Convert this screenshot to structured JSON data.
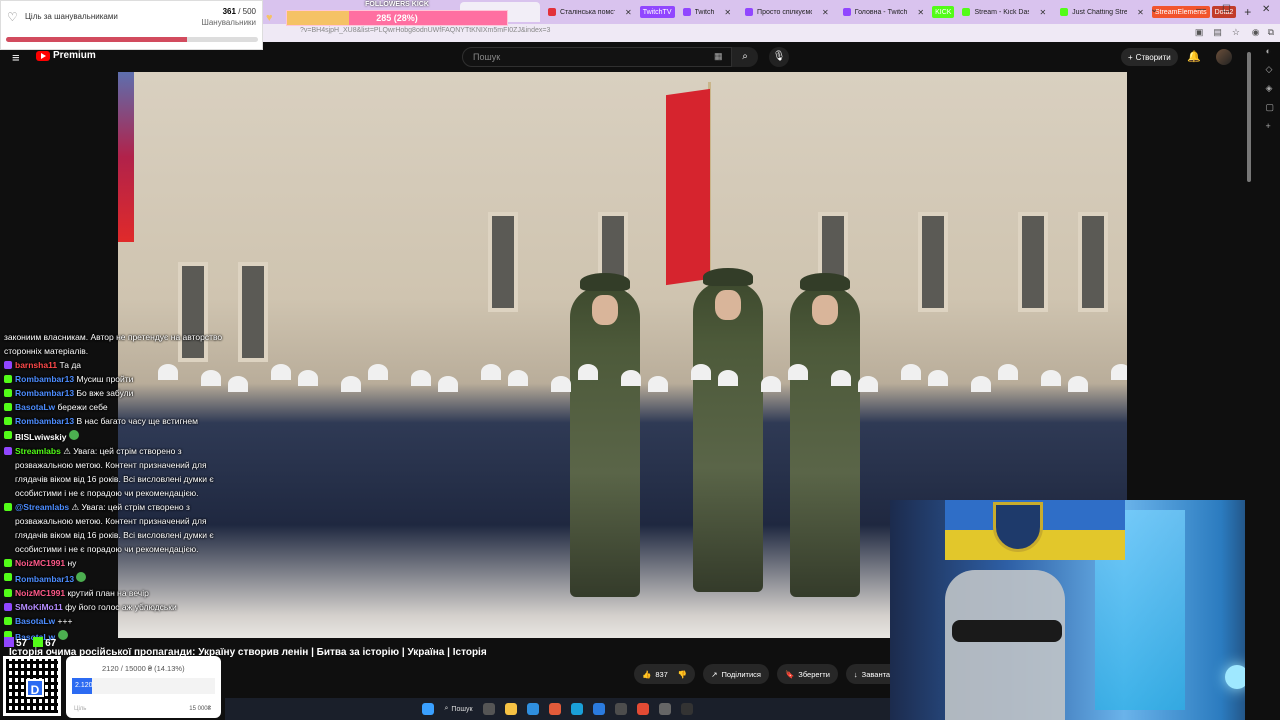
{
  "browser": {
    "tabs": [
      {
        "label": "Сталінська помста",
        "color": "#e2313a"
      },
      {
        "label": "Twitch",
        "color": "#9146ff"
      },
      {
        "label": "Просто спілкуємося",
        "color": "#9146ff"
      },
      {
        "label": "Головна - Twitch",
        "color": "#9146ff"
      },
      {
        "label": "Stream - Kick Dashboard",
        "color": "#53fc18"
      },
      {
        "label": "Just Chatting Stream",
        "color": "#53fc18"
      }
    ],
    "tab_badges": [
      "TwitchTV",
      "KICK",
      "StreamElements",
      "Dota2"
    ],
    "new_tab": "+",
    "url": "?v=BH4sjpH_XU8&list=PLQwrHobg8odnUWfFAQNYTtKNIXm5mFI0ZJ&index=3"
  },
  "youtube": {
    "logo_text": "Premium",
    "search_placeholder": "Пошук",
    "create_label": "Створити",
    "video_title": "Історія очима російської пропаганди: Україну створив ленін | Битва за історію | Україна | Історія",
    "actions": {
      "likes": "837",
      "share": "Поділитися",
      "save": "Зберегти",
      "download": "Завантажити"
    }
  },
  "overlay": {
    "goal": {
      "label": "Ціль за шанувальниками",
      "current": "361",
      "total": "500",
      "sub_label": "Шанувальники",
      "progress": 0.72
    },
    "followers": {
      "title": "FOLLOWERS KICK",
      "text": "285 (28%)",
      "progress": 0.28
    },
    "stats": [
      {
        "value": "57",
        "icon": "twitch-icon",
        "color": "#9146ff"
      },
      {
        "value": "67",
        "icon": "kick-icon",
        "color": "#53fc18"
      }
    ],
    "donation": {
      "amount_text": "2120 / 15000 ₴ (14.13%)",
      "bar_text": "2.120",
      "progress": 0.1413,
      "label": "Ціль",
      "goal_value": "15 000₴"
    }
  },
  "chat": [
    {
      "user": "",
      "user_color": "#fff",
      "badge": "",
      "msg": "закониим власникам. Автор не претендує на авторство сторонніх матеріалів."
    },
    {
      "user": "barnsha11",
      "user_color": "#ff4a4a",
      "badge": "#9146ff",
      "msg": "Та да"
    },
    {
      "user": "Rombambar13",
      "user_color": "#4d8dff",
      "badge": "#53fc18",
      "msg": "Мусиш пройти"
    },
    {
      "user": "Rombambar13",
      "user_color": "#4d8dff",
      "badge": "#53fc18",
      "msg": "Бо вже забули"
    },
    {
      "user": "BasotaLw",
      "user_color": "#4d8dff",
      "badge": "#53fc18",
      "msg": "бережи себе"
    },
    {
      "user": "Rombambar13",
      "user_color": "#4d8dff",
      "badge": "#53fc18",
      "msg": "В нас багато часу ще встигнем"
    },
    {
      "user": "BISLwiwskiy",
      "user_color": "#fff",
      "badge": "#53fc18",
      "msg": ""
    },
    {
      "user": "Streamlabs",
      "user_color": "#53fc18",
      "badge": "#9146ff",
      "msg": "⚠ Увага: цей стрім створено з розважальною метою. Контент призначений для глядачів віком від 16 років. Всі висловлені думки є особистими і не є порадою чи рекомендацією."
    },
    {
      "user": "@Streamlabs",
      "user_color": "#4d8dff",
      "badge": "#53fc18",
      "msg": "⚠ Увага: цей стрім створено з розважальною метою. Контент призначений для глядачів віком від 16 років. Всі висловлені думки є особистими і не є порадою чи рекомендацією."
    },
    {
      "user": "NoizMC1991",
      "user_color": "#ff5a8a",
      "badge": "#53fc18",
      "msg": "ну"
    },
    {
      "user": "Rombambar13",
      "user_color": "#4d8dff",
      "badge": "#53fc18",
      "msg": ""
    },
    {
      "user": "NoizMC1991",
      "user_color": "#ff5a8a",
      "badge": "#53fc18",
      "msg": "крутий план на вечір"
    },
    {
      "user": "SMoKiMo11",
      "user_color": "#b58cff",
      "badge": "#9146ff",
      "msg": "фу його голос аж ублюдськи"
    },
    {
      "user": "BasotaLw",
      "user_color": "#4d8dff",
      "badge": "#53fc18",
      "msg": "+++"
    },
    {
      "user": "BasotaLw",
      "user_color": "#4d8dff",
      "badge": "#53fc18",
      "msg": ""
    }
  ],
  "taskbar": {
    "search_label": "Пошук"
  }
}
